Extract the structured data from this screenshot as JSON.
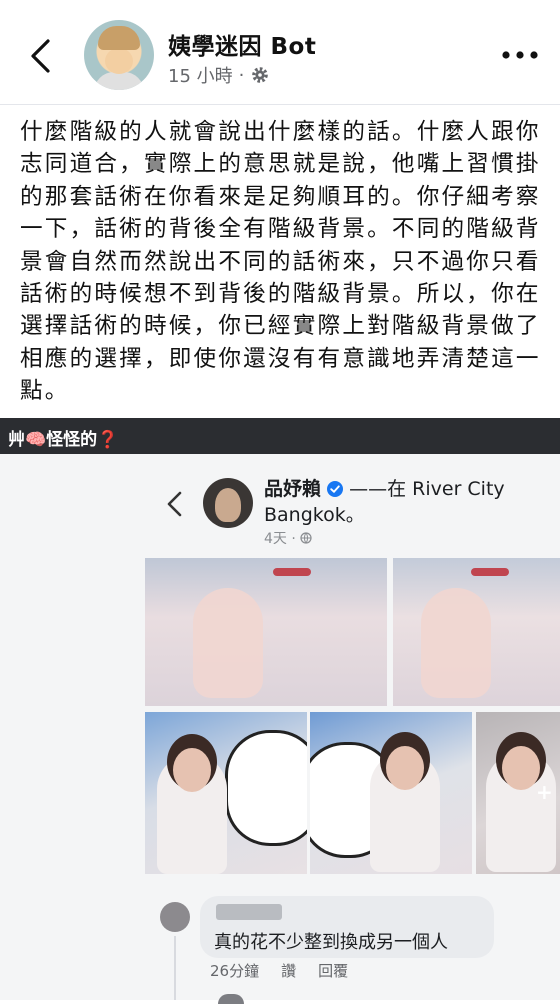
{
  "header": {
    "title": "姨學迷因 Bot",
    "timestamp": "15 小時",
    "separator": "·"
  },
  "post": {
    "text": "什麼階級的人就會說出什麼樣的話。什麼人跟你志同道合，實際上的意思就是說，他嘴上習慣掛的那套話術在你看來是足夠順耳的。你仔細考察一下，話術的背後全有階級背景。不同的階級背景會自然而然說出不同的話術來，只不過你只看話術的時候想不到背後的階級背景。所以，你在選擇話術的時候，你已經實際上對階級背景做了相應的選擇，即使你還沒有有意識地弄清楚這一點。"
  },
  "banner": {
    "text": "艸🧠怪怪的❓"
  },
  "embedded": {
    "name": "品妤賴",
    "location_prefix": "——在 River City",
    "location_suffix": "Bangkok。",
    "time": "4天 ·",
    "more_photos": "+",
    "comment": {
      "text": "真的花不少整到換成另一個人",
      "time": "26分鐘",
      "like": "讚",
      "reply": "回覆"
    }
  },
  "colors": {
    "banner_bg": "#2b2d31",
    "meta_gray": "#65676b",
    "verified_blue": "#1877f2"
  }
}
